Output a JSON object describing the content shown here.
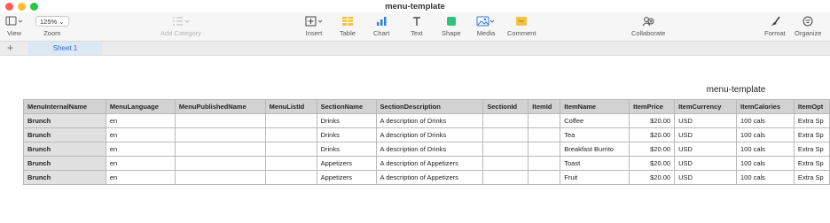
{
  "window": {
    "title": "menu-template"
  },
  "toolbar": {
    "view_label": "View",
    "zoom_value": "125%",
    "zoom_label": "Zoom",
    "add_category_label": "Add Category",
    "insert_label": "Insert",
    "table_label": "Table",
    "chart_label": "Chart",
    "text_label": "Text",
    "shape_label": "Shape",
    "media_label": "Media",
    "comment_label": "Comment",
    "collaborate_label": "Collaborate",
    "format_label": "Format",
    "organize_label": "Organize"
  },
  "sheets": {
    "add_label": "+",
    "active": "Sheet 1"
  },
  "table": {
    "title": "menu-template",
    "columns": [
      "MenuInternalName",
      "MenuLanguage",
      "MenuPublishedName",
      "MenuListId",
      "SectionName",
      "SectionDescription",
      "SectionId",
      "ItemId",
      "ItemName",
      "ItemPrice",
      "ItemCurrency",
      "ItemCalories",
      "ItemOpt"
    ],
    "rows": [
      [
        "Brunch",
        "en",
        "",
        "",
        "Drinks",
        "A description of Drinks",
        "",
        "",
        "Coffee",
        "$20.00",
        "USD",
        "100 cals",
        "Extra Sp"
      ],
      [
        "Brunch",
        "en",
        "",
        "",
        "Drinks",
        "A description of Drinks",
        "",
        "",
        "Tea",
        "$20.00",
        "USD",
        "100 cals",
        "Extra Sp"
      ],
      [
        "Brunch",
        "en",
        "",
        "",
        "Drinks",
        "A description of Drinks",
        "",
        "",
        "Breakfast Burrito",
        "$20.00",
        "USD",
        "100 cals",
        "Extra Sp"
      ],
      [
        "Brunch",
        "en",
        "",
        "",
        "Appetizers",
        "A description of Appetizers",
        "",
        "",
        "Toast",
        "$20.00",
        "USD",
        "100 cals",
        "Extra Sp"
      ],
      [
        "Brunch",
        "en",
        "",
        "",
        "Appetizers",
        "A description of Appetizers",
        "",
        "",
        "Fruit",
        "$20.00",
        "USD",
        "100 cals",
        "Extra Sp"
      ]
    ]
  },
  "colors": {
    "accent": "#2a6fd6",
    "close": "#fe5f57",
    "minimize": "#febc2e",
    "maximize": "#28c840",
    "table_icon": "#f5c242",
    "shape_icon": "#2ec27e",
    "comment_icon": "#f5c242"
  },
  "icons": [
    "sidebar-view-icon",
    "list-category-icon",
    "insert-icon",
    "table-icon",
    "chart-icon",
    "text-icon",
    "shape-icon",
    "media-icon",
    "comment-icon",
    "collaborate-icon",
    "format-brush-icon",
    "organize-icon"
  ]
}
